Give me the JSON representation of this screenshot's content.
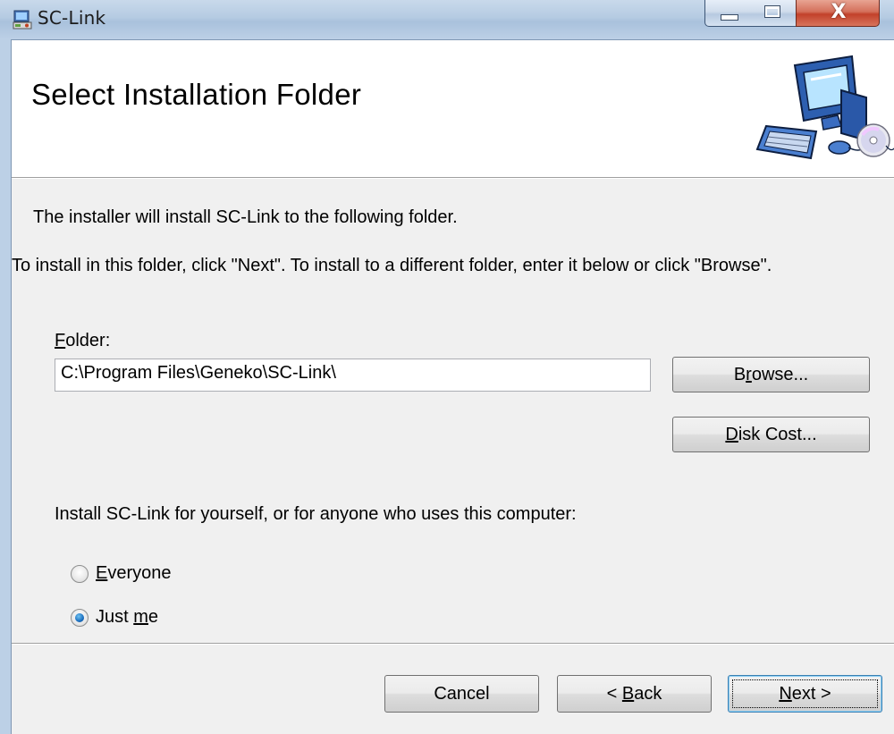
{
  "window": {
    "title": "SC-Link",
    "close_glyph": "X"
  },
  "banner": {
    "title": "Select Installation Folder",
    "art_icon": "computer-cd-icon"
  },
  "body": {
    "line1": "The installer will install SC-Link to the following folder.",
    "line2": "To install in this folder, click \"Next\". To install to a different folder, enter it below or click \"Browse\".",
    "folder_label_accel": "F",
    "folder_label_rest": "older:",
    "folder_value": "C:\\Program Files\\Geneko\\SC-Link\\",
    "browse_pre": "B",
    "browse_accel": "r",
    "browse_post": "owse...",
    "diskcost_accel": "D",
    "diskcost_post": "isk Cost...",
    "install_for_text": "Install SC-Link for yourself, or for anyone who uses this computer:",
    "radio_everyone_accel": "E",
    "radio_everyone_rest": "veryone",
    "radio_justme_pre": "Just ",
    "radio_justme_accel": "m",
    "radio_justme_post": "e",
    "selected_option": "Just me"
  },
  "footer": {
    "cancel_label": "Cancel",
    "back_pre": "< ",
    "back_accel": "B",
    "back_post": "ack",
    "next_accel": "N",
    "next_post": "ext >"
  }
}
